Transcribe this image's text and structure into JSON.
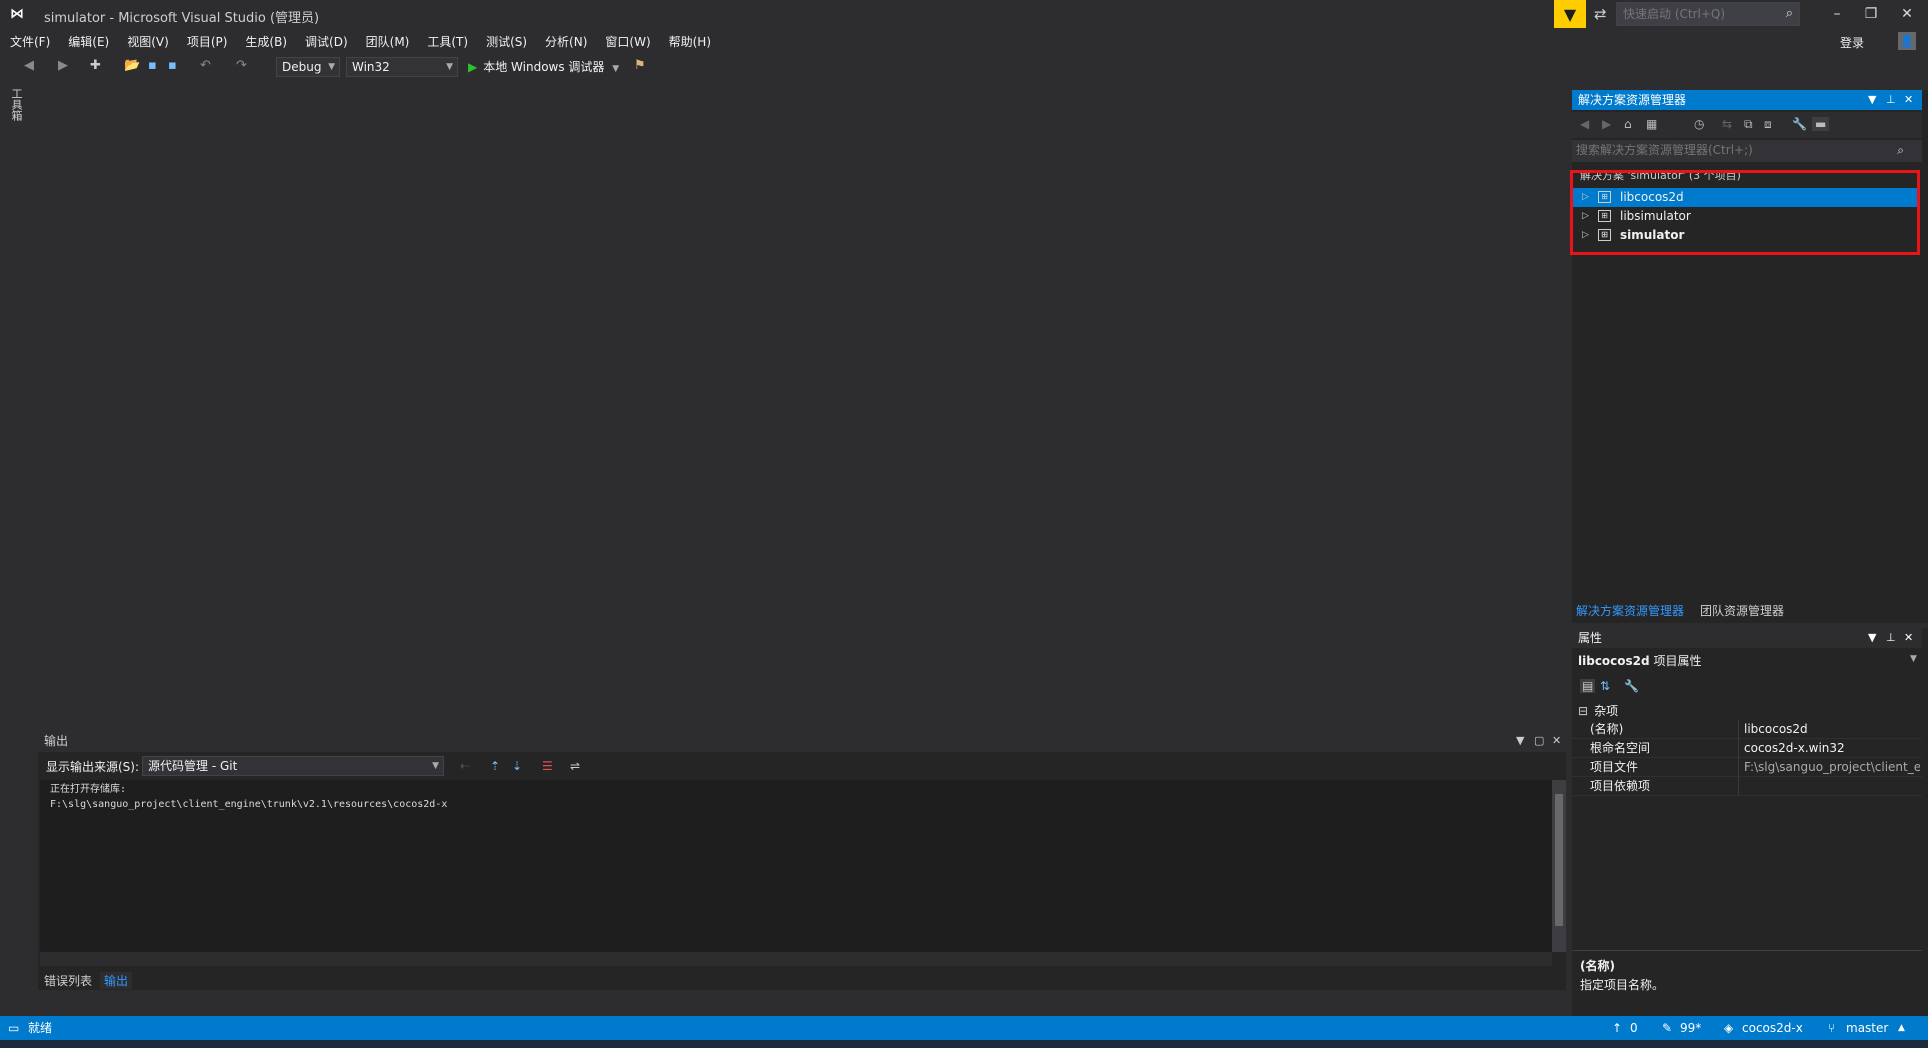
{
  "window": {
    "title": "simulator - Microsoft Visual Studio (管理员)",
    "quick_launch_placeholder": "快速启动 (Ctrl+Q)",
    "login_label": "登录"
  },
  "menu": {
    "items": [
      "文件(F)",
      "编辑(E)",
      "视图(V)",
      "项目(P)",
      "生成(B)",
      "调试(D)",
      "团队(M)",
      "工具(T)",
      "测试(S)",
      "分析(N)",
      "窗口(W)",
      "帮助(H)"
    ]
  },
  "toolbar": {
    "configuration": "Debug",
    "platform": "Win32",
    "run_label": "本地 Windows 调试器"
  },
  "toolbox": {
    "label": "工具箱"
  },
  "solution_explorer": {
    "title": "解决方案资源管理器",
    "search_placeholder": "搜索解决方案资源管理器(Ctrl+;)",
    "root_label": "解决方案 'simulator' (3 个项目)",
    "projects": [
      {
        "name": "libcocos2d",
        "selected": true,
        "bold": false
      },
      {
        "name": "libsimulator",
        "selected": false,
        "bold": false
      },
      {
        "name": "simulator",
        "selected": false,
        "bold": true
      }
    ],
    "tabs": [
      "解决方案资源管理器",
      "团队资源管理器"
    ]
  },
  "properties": {
    "title": "属性",
    "object_name": "libcocos2d",
    "object_type": "项目属性",
    "category": "杂项",
    "rows": [
      {
        "name": "(名称)",
        "value": "libcocos2d"
      },
      {
        "name": "根命名空间",
        "value": "cocos2d-x.win32"
      },
      {
        "name": "项目文件",
        "value": "F:\\slg\\sanguo_project\\client_e"
      },
      {
        "name": "项目依赖项",
        "value": ""
      }
    ],
    "desc_title": "(名称)",
    "desc_text": "指定项目名称。"
  },
  "output": {
    "title": "输出",
    "source_label": "显示输出来源(S):",
    "source_value": "源代码管理 - Git",
    "lines": [
      "正在打开存储库:",
      "F:\\slg\\sanguo_project\\client_engine\\trunk\\v2.1\\resources\\cocos2d-x"
    ],
    "tabs": [
      "错误列表",
      "输出"
    ]
  },
  "statusbar": {
    "status": "就绪",
    "publish_count": "0",
    "pending_changes": "99*",
    "repo": "cocos2d-x",
    "branch": "master"
  },
  "colors": {
    "accent": "#007acc",
    "background": "#2d2d30",
    "highlight_box": "#e8141a",
    "filter": "#ffcc00"
  }
}
